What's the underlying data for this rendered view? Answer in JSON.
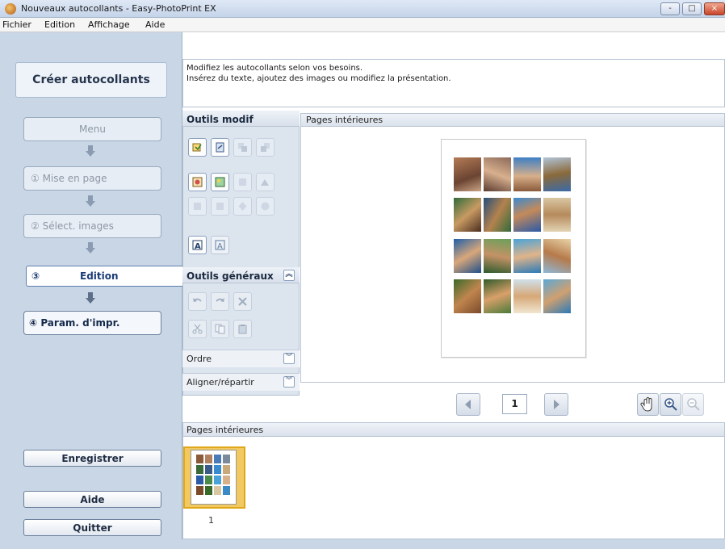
{
  "window": {
    "title": "Nouveaux autocollants - Easy-PhotoPrint EX",
    "controls": {
      "minimize": "-",
      "maximize": "□",
      "close": "×"
    }
  },
  "menubar": {
    "items": [
      "Fichier",
      "Edition",
      "Affichage",
      "Aide"
    ]
  },
  "sidebar": {
    "header": "Créer autocollants",
    "steps": [
      {
        "label": "Menu",
        "state": "done"
      },
      {
        "label": "① Mise en page",
        "state": "done"
      },
      {
        "label": "② Sélect. images",
        "state": "done"
      },
      {
        "label": "Edition",
        "number": "③",
        "state": "active"
      },
      {
        "label": "④ Param. d'impr.",
        "state": "next"
      }
    ],
    "save_label": "Enregistrer",
    "help_label": "Aide",
    "quit_label": "Quitter"
  },
  "instructions": {
    "line1": "Modifiez les autocollants selon vos besoins.",
    "line2": "Insérez du texte, ajoutez des images ou modifiez la présentation."
  },
  "tools": {
    "edit_title": "Outils modif",
    "general_title": "Outils généraux",
    "order_label": "Ordre",
    "align_label": "Aligner/répartir"
  },
  "preview": {
    "title": "Pages intérieures",
    "page_number": "1"
  },
  "thumbnails": {
    "title": "Pages intérieures",
    "items": [
      {
        "label": "1"
      }
    ]
  },
  "colors": {
    "sidebar_bg": "#c9d6e5",
    "active_step_text": "#1a3c76",
    "thumb_highlight": "#f2c860"
  }
}
